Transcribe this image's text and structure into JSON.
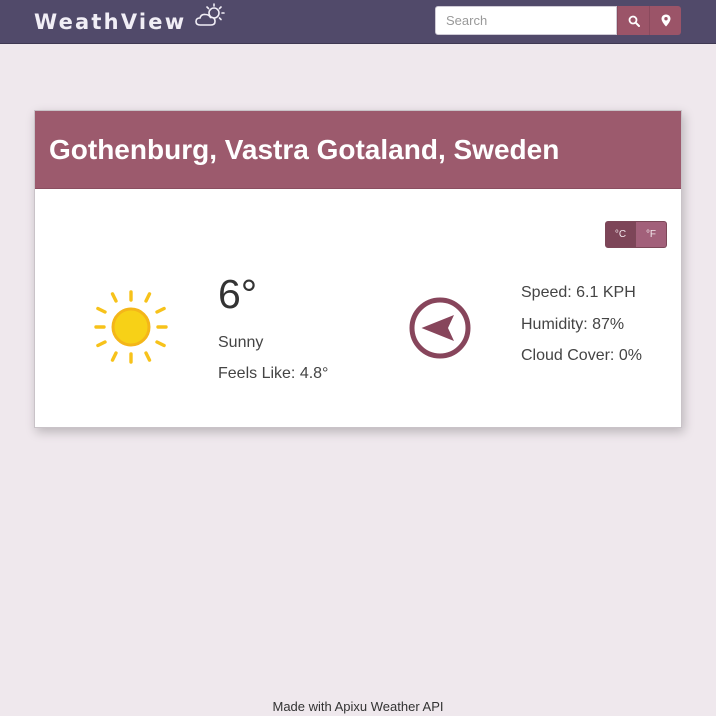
{
  "navbar": {
    "brand": "WeathView",
    "brand_icon": "cloud-sun-icon",
    "search_placeholder": "Search",
    "search_button_icon": "search-icon",
    "location_button_icon": "map-marker-icon"
  },
  "card": {
    "location": "Gothenburg, Vastra Gotaland, Sweden",
    "units": {
      "celsius": "°C",
      "fahrenheit": "°F",
      "selected": "°C"
    },
    "weather_icon": "sun-icon",
    "temperature": "6°",
    "condition": "Sunny",
    "feels_like": "Feels Like: 4.8°",
    "wind_icon": "wind-direction-arrow-icon",
    "speed": "Speed: 6.1 KPH",
    "humidity": "Humidity: 87%",
    "cloud_cover": "Cloud Cover: 0%"
  },
  "footer": {
    "text": "Made with Apixu Weather API"
  },
  "colors": {
    "navbar_bg": "#514a6a",
    "accent": "#9c5a6d",
    "page_bg": "#efe8ed",
    "sun_yellow": "#f7d117"
  }
}
